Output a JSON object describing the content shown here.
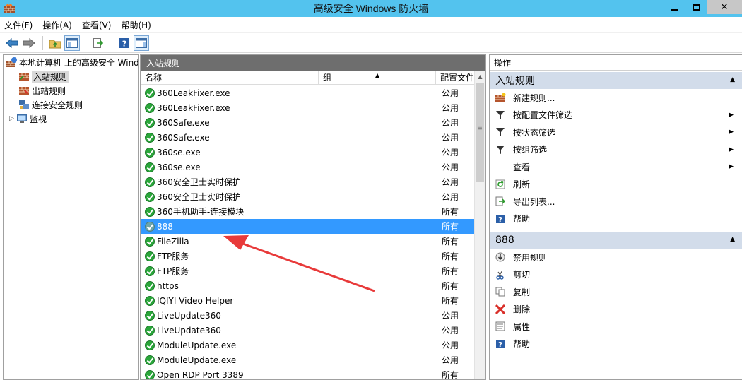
{
  "window": {
    "title": "高级安全 Windows 防火墙"
  },
  "menu": [
    "文件(F)",
    "操作(A)",
    "查看(V)",
    "帮助(H)"
  ],
  "tree": {
    "root": "本地计算机 上的高级安全 Windows 防火墙",
    "items": [
      "入站规则",
      "出站规则",
      "连接安全规则",
      "监视"
    ]
  },
  "center": {
    "title": "入站规则",
    "columns": {
      "name": "名称",
      "group": "组",
      "profile": "配置文件"
    },
    "rows": [
      {
        "name": "360LeakFixer.exe",
        "profile": "公用"
      },
      {
        "name": "360LeakFixer.exe",
        "profile": "公用"
      },
      {
        "name": "360Safe.exe",
        "profile": "公用"
      },
      {
        "name": "360Safe.exe",
        "profile": "公用"
      },
      {
        "name": "360se.exe",
        "profile": "公用"
      },
      {
        "name": "360se.exe",
        "profile": "公用"
      },
      {
        "name": "360安全卫士实时保护",
        "profile": "公用"
      },
      {
        "name": "360安全卫士实时保护",
        "profile": "公用"
      },
      {
        "name": "360手机助手-连接模块",
        "profile": "所有"
      },
      {
        "name": "888",
        "profile": "所有"
      },
      {
        "name": "FileZilla",
        "profile": "所有"
      },
      {
        "name": "FTP服务",
        "profile": "所有"
      },
      {
        "name": "FTP服务",
        "profile": "所有"
      },
      {
        "name": "https",
        "profile": "所有"
      },
      {
        "name": "IQIYI Video Helper",
        "profile": "所有"
      },
      {
        "name": "LiveUpdate360",
        "profile": "公用"
      },
      {
        "name": "LiveUpdate360",
        "profile": "公用"
      },
      {
        "name": "ModuleUpdate.exe",
        "profile": "公用"
      },
      {
        "name": "ModuleUpdate.exe",
        "profile": "公用"
      },
      {
        "name": "Open RDP Port 3389",
        "profile": "所有"
      }
    ]
  },
  "actions": {
    "header": "操作",
    "section1": "入站规则",
    "list1": [
      "新建规则...",
      "按配置文件筛选",
      "按状态筛选",
      "按组筛选",
      "查看",
      "刷新",
      "导出列表...",
      "帮助"
    ],
    "section2": "888",
    "list2": [
      "禁用规则",
      "剪切",
      "复制",
      "删除",
      "属性",
      "帮助"
    ]
  }
}
